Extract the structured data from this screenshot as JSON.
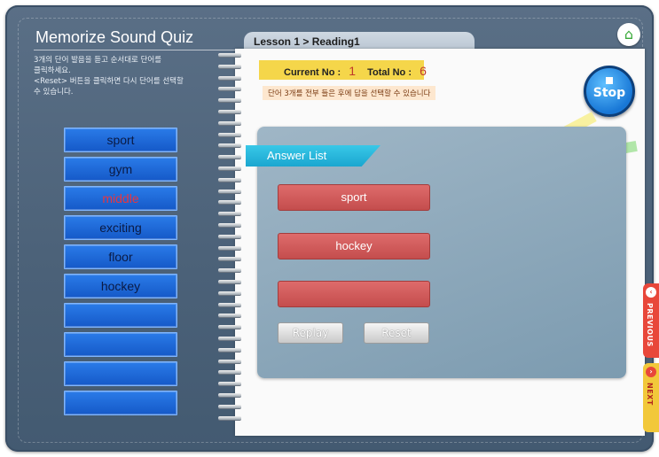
{
  "app": {
    "title": "Memorize Sound Quiz",
    "instructions": "3개의 단어 발음을 듣고 순서대로 단어를\n클릭하세요.\n<Reset> 버튼을 클릭하면 다시 단어를 선택할\n수 있습니다."
  },
  "words": [
    {
      "label": "sport",
      "state": "normal"
    },
    {
      "label": "gym",
      "state": "normal"
    },
    {
      "label": "middle",
      "state": "selected"
    },
    {
      "label": "exciting",
      "state": "normal"
    },
    {
      "label": "floor",
      "state": "normal"
    },
    {
      "label": "hockey",
      "state": "normal"
    },
    {
      "label": "",
      "state": "empty"
    },
    {
      "label": "",
      "state": "empty"
    },
    {
      "label": "",
      "state": "empty"
    },
    {
      "label": "",
      "state": "empty"
    }
  ],
  "breadcrumb": "Lesson 1 > Reading1",
  "counter": {
    "current_label": "Current No :",
    "current_value": "1",
    "total_label": "Total No :",
    "total_value": "6"
  },
  "hint": "단어 3개를 전부 들은 후에 답을 선택할 수 있습니다",
  "stop_label": "Stop",
  "answer_list": {
    "title": "Answer List",
    "answers": [
      "sport",
      "hockey",
      ""
    ],
    "replay_label": "Replay",
    "reset_label": "Reset"
  },
  "nav": {
    "previous_label": "PREVIOUS",
    "next_label": "NEXT"
  },
  "colors": {
    "accent_blue": "#1559c8",
    "selected_word": "#e8363e",
    "answer_red": "#c44d4d",
    "counter_yellow": "#f5d64a"
  },
  "icons": {
    "home": "home-icon",
    "stop": "stop-square-icon",
    "previous": "chevron-left-icon",
    "next": "chevron-right-icon"
  }
}
